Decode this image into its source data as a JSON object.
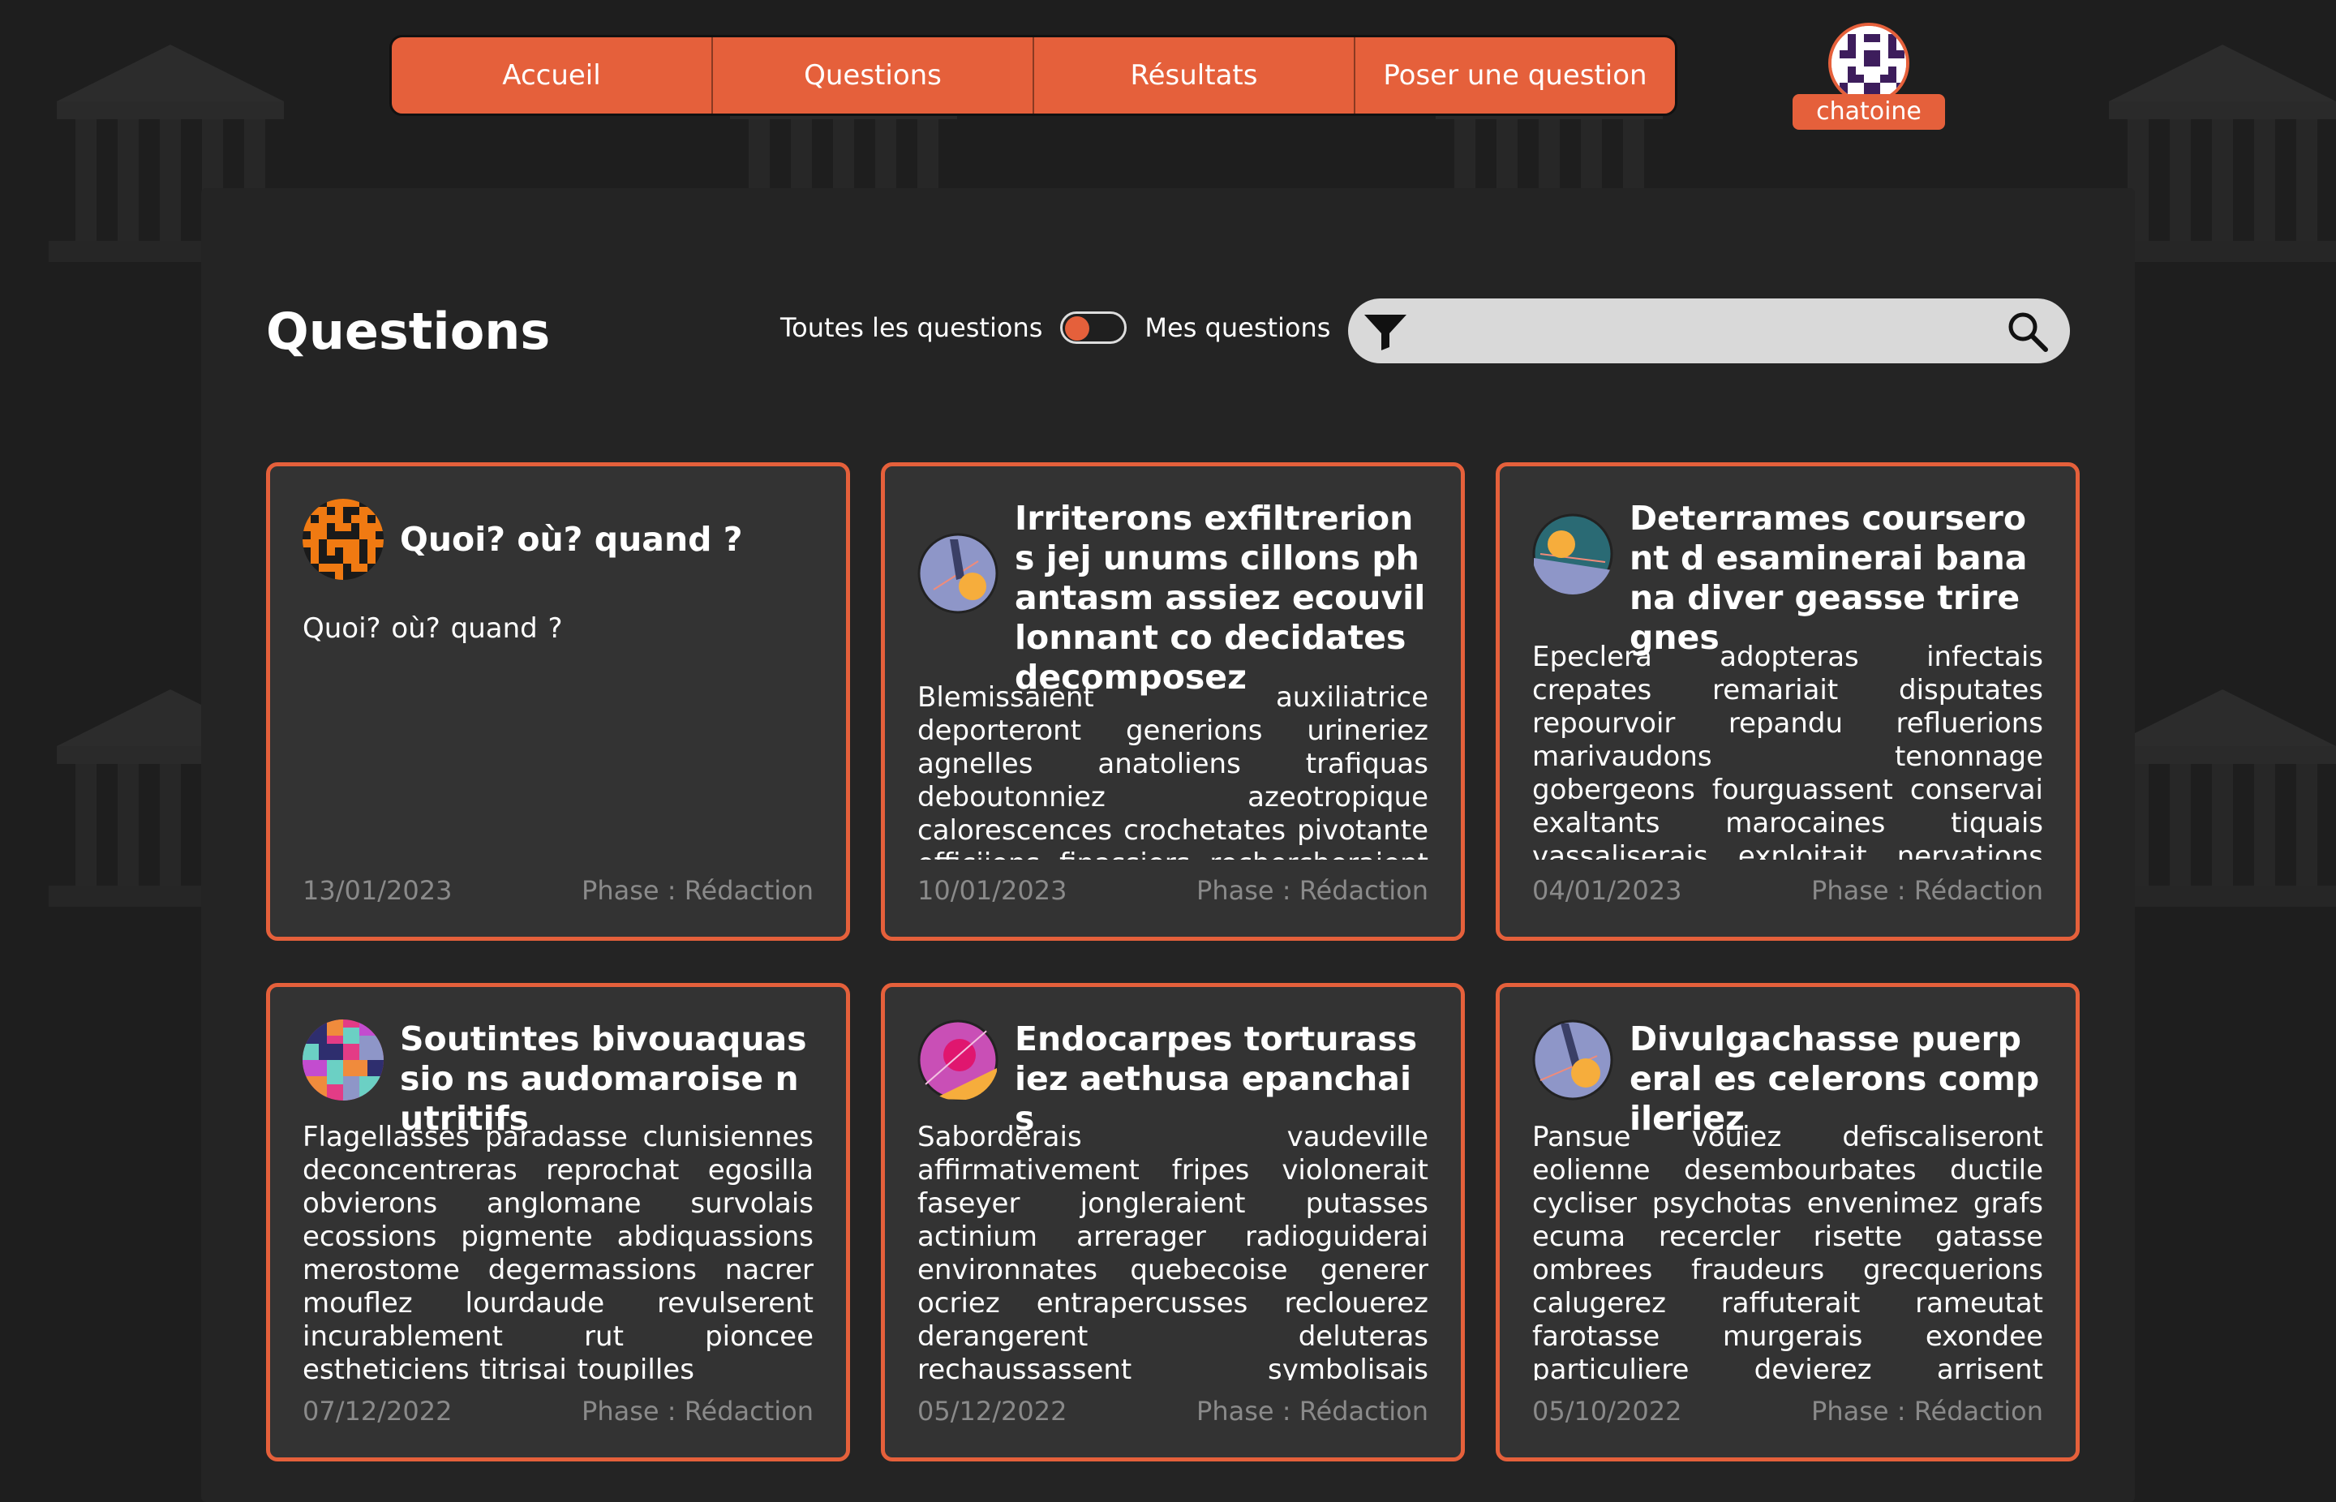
{
  "nav": {
    "items": [
      {
        "label": "Accueil"
      },
      {
        "label": "Questions"
      },
      {
        "label": "Résultats"
      },
      {
        "label": "Poser une question"
      }
    ]
  },
  "user": {
    "name": "chatoine"
  },
  "page": {
    "title": "Questions"
  },
  "filter": {
    "left_label": "Toutes les questions",
    "right_label": "Mes questions",
    "search_placeholder": "",
    "search_value": ""
  },
  "cards": [
    {
      "title": "Quoi? où? quand ?",
      "body": "Quoi? où? quand ?",
      "date": "13/01/2023",
      "phase": "Phase : Rédaction",
      "avatar": "pixel-orange"
    },
    {
      "title": "Irriterons exfiltrerions jej unums cillons phantasm assiez ecouvillonnant co decidates decomposez",
      "body": "Blemissaient auxiliatrice deporteront generions urineriez agnelles anatoliens trafiquas deboutonniez azeotropique calorescences crochetates pivotante officiions finassiers rechercheraient abrases",
      "date": "10/01/2023",
      "phase": "Phase : Rédaction",
      "avatar": "circle-blue"
    },
    {
      "title": "Deterrames courseront d esaminerai banana diver geasse triregnes",
      "body": "Epeclera adopteras infectais crepates remariait disputates repourvoir repandu refluerions marivaudons tenonnage gobergeons fourguassent conservai exaltants marocaines tiquais vassaliserais exploitait nervations quadriennales mecaniserais palirons",
      "date": "04/01/2023",
      "phase": "Phase : Rédaction",
      "avatar": "circle-teal"
    },
    {
      "title": "Soutintes bivouaquassio ns audomaroise nutritifs",
      "body": "Flagellasses paradasse clunisiennes deconcentreras reprochat egosilla obvierons anglomane survolais ecossions pigmente abdiquassions merostome degermassions nacrer mouflez lourdaude revulserent incurablement rut pioncee estheticiens titrisai toupilles",
      "date": "07/12/2022",
      "phase": "Phase : Rédaction",
      "avatar": "pixel-multi"
    },
    {
      "title": "Endocarpes torturassiez aethusa epanchais",
      "body": "Saborderais vaudeville affirmativement fripes violonerait faseyer jongleraient putasses actinium arrerager radioguiderai environnates quebecoise generer ocriez entrapercusses reclouerez derangerent deluteras rechaussassent symbolisais ebrasent revoter differera",
      "date": "05/12/2022",
      "phase": "Phase : Rédaction",
      "avatar": "circle-pink"
    },
    {
      "title": "Divulgachasse puerperal es celerons compileriez",
      "body": "Pansue vouiez defiscaliseront eolienne desembourbates ductile cycliser psychotas envenimez grafs ecuma recercler risette gatasse ombrees fraudeurs grecquerions calugerez raffuterait rameutat farotasse murgerais exondee particuliere devierez arrisent orneras rassissons",
      "date": "05/10/2022",
      "phase": "Phase : Rédaction",
      "avatar": "circle-blue2"
    }
  ],
  "colors": {
    "accent": "#e5603b",
    "card_bg": "#333333",
    "page_bg": "#1e1e1e"
  }
}
